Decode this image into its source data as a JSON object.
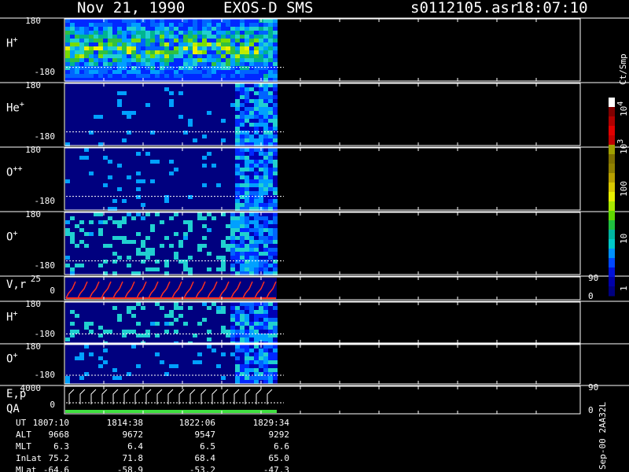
{
  "header": {
    "date": "Nov 21, 1990",
    "mission": "EXOS-D SMS",
    "file": "s0112105.asr",
    "time": "18:07:10"
  },
  "chart_data": {
    "type": "heatmap",
    "panels": [
      {
        "id": "h1",
        "label": "H",
        "charge": "+",
        "ymax": "180",
        "ymin": "-180",
        "kind": "spectrogram",
        "intensity": "strong"
      },
      {
        "id": "he",
        "label": "He",
        "charge": "+",
        "ymax": "180",
        "ymin": "-180",
        "kind": "spectrogram",
        "intensity": "weak"
      },
      {
        "id": "o2",
        "label": "O",
        "charge": "++",
        "ymax": "180",
        "ymin": "-180",
        "kind": "spectrogram",
        "intensity": "weak"
      },
      {
        "id": "o1",
        "label": "O",
        "charge": "+",
        "ymax": "180",
        "ymin": "-180",
        "kind": "spectrogram",
        "intensity": "medium"
      },
      {
        "id": "vr",
        "label": "V,r",
        "charge": "",
        "ymax": "25",
        "ymin": "0",
        "kind": "line",
        "right_top": "90",
        "right_bottom": "0"
      },
      {
        "id": "h2",
        "label": "H",
        "charge": "+",
        "ymax": "180",
        "ymin": "-180",
        "kind": "spectrogram",
        "intensity": "medium"
      },
      {
        "id": "o3",
        "label": "O",
        "charge": "+",
        "ymax": "180",
        "ymin": "-180",
        "kind": "spectrogram",
        "intensity": "weak"
      },
      {
        "id": "ep",
        "label": "E,p",
        "label2": "QA",
        "charge": "",
        "ymax": "4000",
        "ymin": "0",
        "kind": "line",
        "right_top": "90",
        "right_bottom": "0"
      }
    ],
    "colorbar": {
      "unit": "Ct/Smp",
      "ticks": [
        {
          "base": "10",
          "exp": "4"
        },
        {
          "base": "10",
          "exp": "3"
        },
        {
          "base": "100",
          "exp": ""
        },
        {
          "base": "10",
          "exp": ""
        },
        {
          "base": "1",
          "exp": ""
        }
      ],
      "colors": [
        "#00007f",
        "#0000a8",
        "#0010d8",
        "#0048ff",
        "#0090ff",
        "#00c8c8",
        "#00b4a0",
        "#20c040",
        "#60d800",
        "#a8e800",
        "#e8f000",
        "#d8c800",
        "#b8a000",
        "#908000",
        "#807000",
        "#a0a000",
        "#c00000",
        "#e00000",
        "#b00000",
        "#800000",
        "#ffffff"
      ]
    },
    "footer": {
      "rows": [
        {
          "label": "UT",
          "values": [
            "1807:10",
            "1814:38",
            "1822:06",
            "1829:34"
          ]
        },
        {
          "label": "ALT",
          "values": [
            "9668",
            "9672",
            "9547",
            "9292"
          ]
        },
        {
          "label": "MLT",
          "values": [
            "6.3",
            "6.4",
            "6.5",
            "6.6"
          ]
        },
        {
          "label": "InLat",
          "values": [
            "75.2",
            "71.8",
            "68.4",
            "65.0"
          ]
        },
        {
          "label": "MLat",
          "values": [
            "-64.6",
            "-58.9",
            "-53.2",
            "-47.3"
          ]
        }
      ]
    },
    "version_stamp": "Sep-00 2AA32L"
  }
}
